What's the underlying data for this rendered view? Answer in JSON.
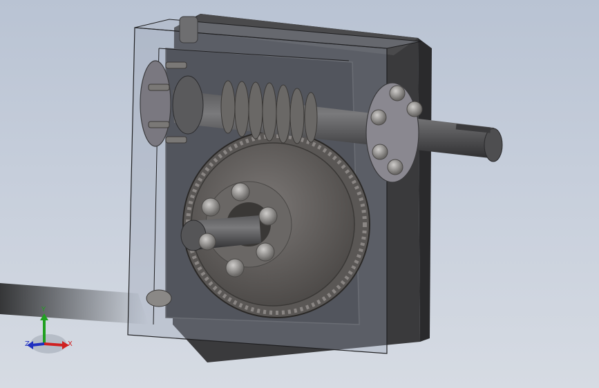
{
  "viewport": {
    "background_top": "#b9c3d3",
    "background_bottom": "#d6dbe3"
  },
  "model": {
    "housing_color": "#3a3a3c",
    "gear_color": "#6b6866",
    "shaft_color": "#4e4e50",
    "flange_color": "#8a8890",
    "bolt_color": "#8c8a88"
  },
  "triad": {
    "x_label": "X",
    "y_label": "Y",
    "z_label": "Z",
    "x_color": "#d02020",
    "y_color": "#20a020",
    "z_color": "#2030c0"
  }
}
